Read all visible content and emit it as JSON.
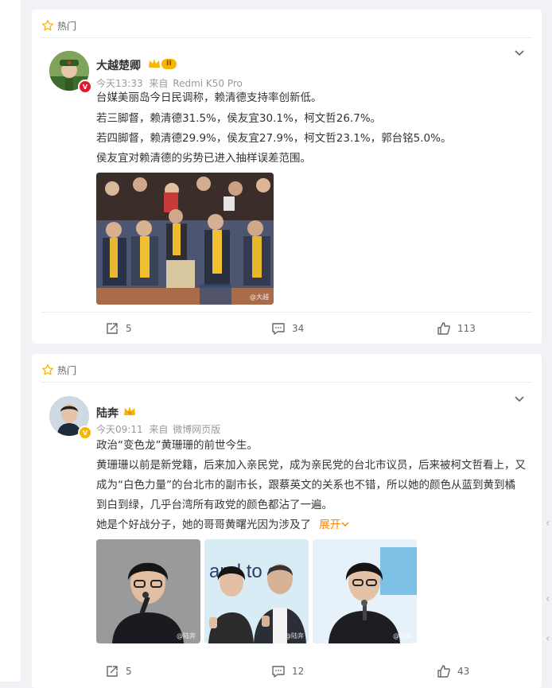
{
  "posts": [
    {
      "tag": "热门",
      "user": "大越楚卿",
      "level": "II",
      "time": "今天13:33",
      "source_prefix": "来自",
      "source": "Redmi K50 Pro",
      "lines": [
        "台媒美丽岛今日民调称，赖清德支持率创新低。",
        "若三脚督，赖清德31.5%，侯友宜30.1%，柯文哲26.7%。",
        "若四脚督，赖清德29.9%，侯友宜27.9%，柯文哲23.1%，郭台铭5.0%。",
        "侯友宜对赖清德的劣势已进入抽样误差范围。"
      ],
      "image_watermark": "@大越",
      "reposts": "5",
      "comments": "34",
      "likes": "113"
    },
    {
      "tag": "热门",
      "user": "陆奔",
      "time": "今天09:11",
      "source_prefix": "来自",
      "source": "微博网页版",
      "title_line": "政治“变色龙”黄珊珊的前世今生。",
      "paragraph": "黄珊珊以前是新党籍，后来加入亲民党，成为亲民党的台北市议员，后来被柯文哲看上，又成为“白色力量”的台北市的副市长，跟蔡英文的关系也不错，所以她的颜色从蓝到黄到橘到白到绿，几乎台湾所有政党的颜色都沾了一遍。",
      "last_line": "她是个好战分子，她的哥哥黄曙光因为涉及了",
      "expand_label": "展开",
      "image_text": "and to e",
      "image_watermarks": [
        "@陆奔",
        "@陆奔",
        "@陆奔"
      ],
      "reposts": "5",
      "comments": "12",
      "likes": "43"
    }
  ],
  "colors": {
    "accent": "#ff8200",
    "vip_gold": "#f7b500",
    "verified_red": "#e6162d",
    "verified_yellow": "#f7b500"
  },
  "icons": [
    "star-icon",
    "chevron-down-icon",
    "repost-icon",
    "comment-icon",
    "like-icon",
    "crown-icon"
  ]
}
